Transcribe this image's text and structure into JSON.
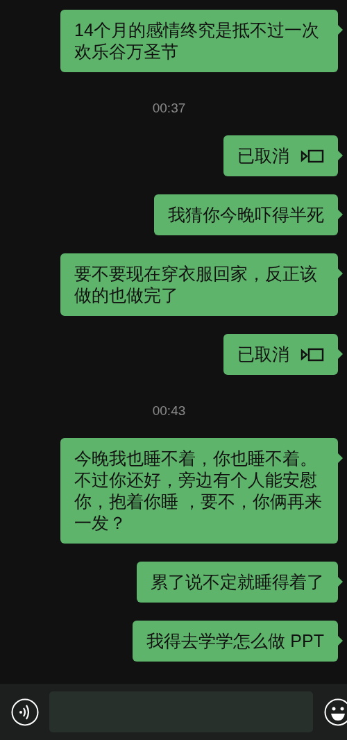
{
  "messages": [
    {
      "kind": "text",
      "text": "14个月的感情终究是抵不过一次欢乐谷万圣节"
    },
    {
      "kind": "time",
      "text": "00:37"
    },
    {
      "kind": "call",
      "text": "已取消"
    },
    {
      "kind": "text",
      "text": "我猜你今晚吓得半死"
    },
    {
      "kind": "text",
      "text": "要不要现在穿衣服回家，反正该做的也做完了"
    },
    {
      "kind": "call",
      "text": "已取消"
    },
    {
      "kind": "time",
      "text": "00:43"
    },
    {
      "kind": "text",
      "text": "今晚我也睡不着，你也睡不着。不过你还好，旁边有个人能安慰你，抱着你睡 ，要不，你俩再来一发？"
    },
    {
      "kind": "text",
      "text": "累了说不定就睡得着了"
    },
    {
      "kind": "text",
      "text": "我得去学学怎么做 PPT"
    }
  ]
}
